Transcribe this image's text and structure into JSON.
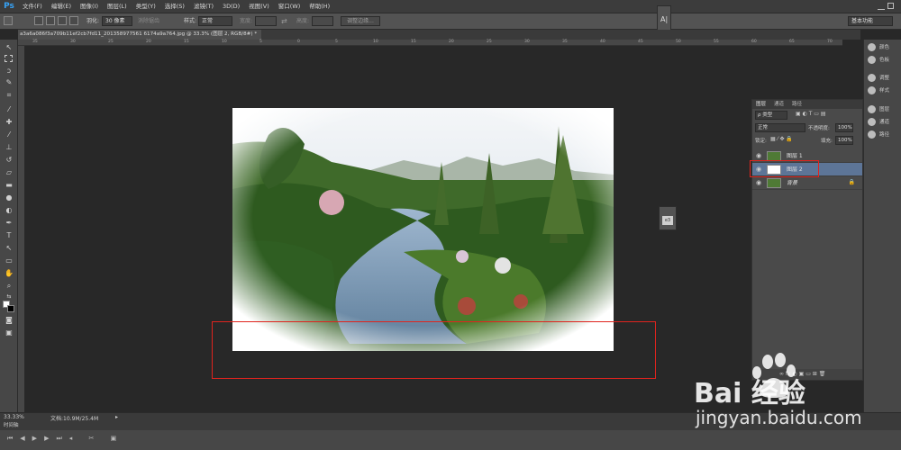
{
  "app": {
    "logo": "Ps"
  },
  "menu": [
    "文件(F)",
    "编辑(E)",
    "图像(I)",
    "图层(L)",
    "类型(Y)",
    "选择(S)",
    "滤镜(T)",
    "3D(D)",
    "视图(V)",
    "窗口(W)",
    "帮助(H)"
  ],
  "options": {
    "feather_label": "羽化:",
    "feather_value": "30 像素",
    "antialias_label": "消除锯齿",
    "style_label": "样式:",
    "style_value": "正常",
    "width_label": "宽度:",
    "height_label": "高度:",
    "refine_edge_label": "调整边缘...",
    "workspace": "基本功能"
  },
  "document": {
    "tab_title": "a3a6a086f3a709b11ef2cb7fd11_201358977561 6174a9a764.jpg @ 33.3% (图层 2, RGB/8#) *",
    "zoom": "33.33%",
    "doc_info": "文档:10.9M/25.4M",
    "ruler_ticks": [
      "35",
      "30",
      "25",
      "20",
      "15",
      "10",
      "5",
      "0",
      "5",
      "10",
      "15",
      "20",
      "25",
      "30",
      "35",
      "40",
      "45",
      "50",
      "55",
      "60",
      "65",
      "70"
    ]
  },
  "right_dock": {
    "items": [
      "颜色",
      "色板",
      "调整",
      "样式",
      "图层",
      "通道",
      "路径"
    ]
  },
  "layers_panel": {
    "tabs": [
      "图层",
      "通道",
      "路径"
    ],
    "filter_label": "ρ 类型",
    "blend_mode": "正常",
    "opacity_label": "不透明度:",
    "opacity_value": "100%",
    "lock_label": "锁定:",
    "fill_label": "填充:",
    "fill_value": "100%",
    "layers": [
      {
        "name": "图层 1",
        "selected": false
      },
      {
        "name": "图层 2",
        "selected": true
      },
      {
        "name": "背景",
        "selected": false
      }
    ]
  },
  "timeline": {
    "label": "时间轴"
  },
  "watermark": {
    "brand": "Bai 经验",
    "url": "jingyan.baidu.com"
  },
  "colors": {
    "selection_red": "#e0241e",
    "selected_layer": "#5d7597",
    "ps_blue": "#37a2f5"
  }
}
